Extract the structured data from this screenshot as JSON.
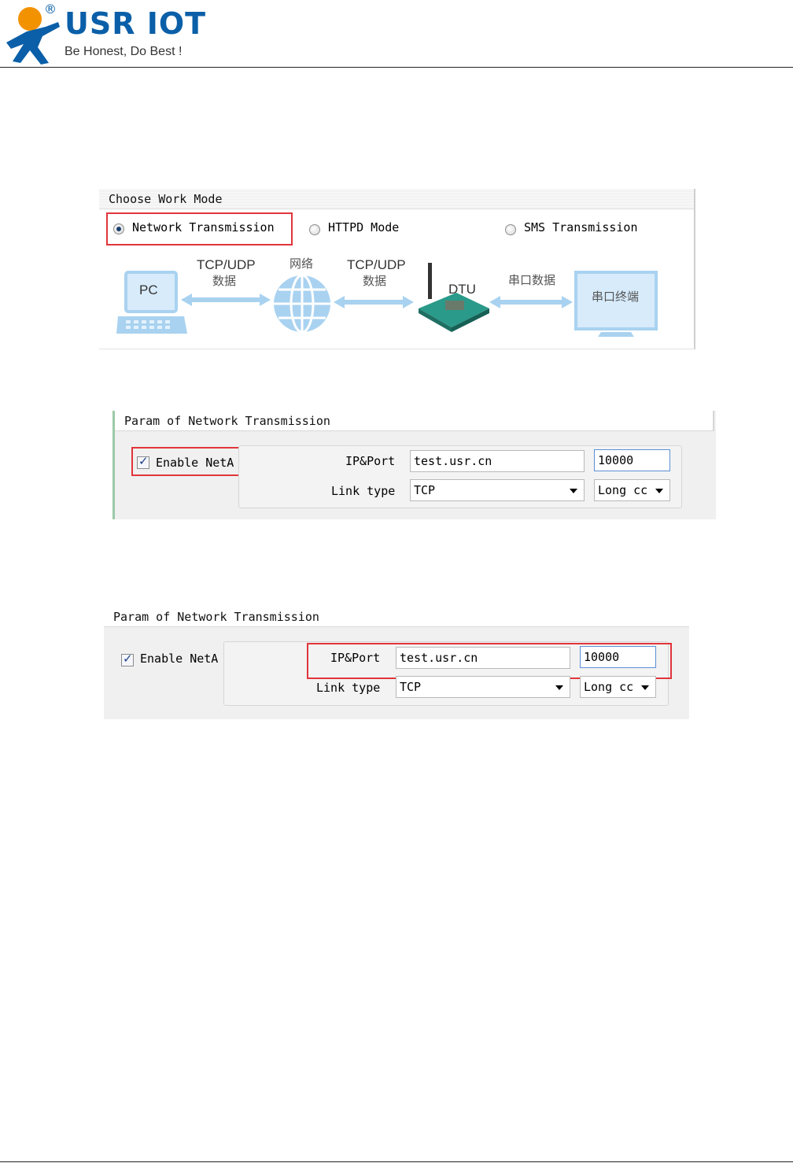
{
  "header": {
    "brand": "USR IOT",
    "registered_mark": "®",
    "slogan": "Be Honest, Do Best !"
  },
  "work_mode_panel": {
    "title": "Choose Work Mode",
    "options": [
      {
        "label": "Network Transmission",
        "selected": true
      },
      {
        "label": "HTTPD Mode",
        "selected": false
      },
      {
        "label": "SMS Transmission",
        "selected": false
      }
    ],
    "diagram": {
      "pc": "PC",
      "link1": "TCP/UDP",
      "link1_sub": "数据",
      "network": "网络",
      "link2": "TCP/UDP",
      "link2_sub": "数据",
      "dtu": "DTU",
      "serial_data": "串口数据",
      "serial_terminal": "串口终端"
    }
  },
  "param_panel_1": {
    "title": "Param of Network Transmission",
    "enable_label": "Enable NetA",
    "enable_checked": true,
    "ip_port_label": "IP&Port",
    "ip_value": "test.usr.cn",
    "port_value": "10000",
    "link_type_label": "Link type",
    "link_type_value": "TCP",
    "conn_value": "Long cc"
  },
  "param_panel_2": {
    "title": "Param of Network Transmission",
    "enable_label": "Enable NetA",
    "enable_checked": true,
    "ip_port_label": "IP&Port",
    "ip_value": "test.usr.cn",
    "port_value": "10000",
    "link_type_label": "Link type",
    "link_type_value": "TCP",
    "conn_value": "Long cc"
  },
  "colors": {
    "brand": "#0a5fa8",
    "logo_orange": "#f39200",
    "highlight": "#e0353b",
    "diagram_blue": "#a9d2f0"
  }
}
